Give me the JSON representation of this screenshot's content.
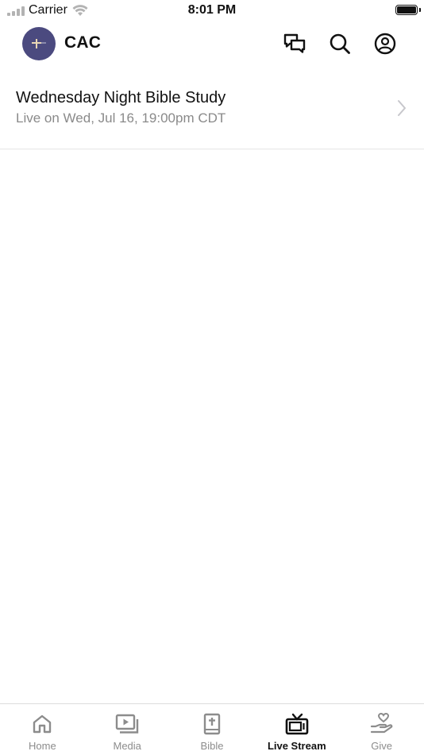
{
  "status_bar": {
    "carrier": "Carrier",
    "time": "8:01 PM"
  },
  "header": {
    "title": "CAC",
    "icons": [
      "chat-icon",
      "search-icon",
      "profile-icon"
    ]
  },
  "stream": {
    "title": "Wednesday Night Bible Study",
    "subtitle": "Live on Wed, Jul 16, 19:00pm CDT"
  },
  "tabs": [
    {
      "label": "Home",
      "icon": "home-icon",
      "active": false
    },
    {
      "label": "Media",
      "icon": "media-icon",
      "active": false
    },
    {
      "label": "Bible",
      "icon": "bible-icon",
      "active": false
    },
    {
      "label": "Live Stream",
      "icon": "tv-icon",
      "active": true
    },
    {
      "label": "Give",
      "icon": "give-icon",
      "active": false
    }
  ],
  "colors": {
    "logo_background": "#4b4a7f",
    "active_tab": "#111111",
    "inactive_tab": "#8c8c8c",
    "subtitle": "#8a8a8a"
  }
}
